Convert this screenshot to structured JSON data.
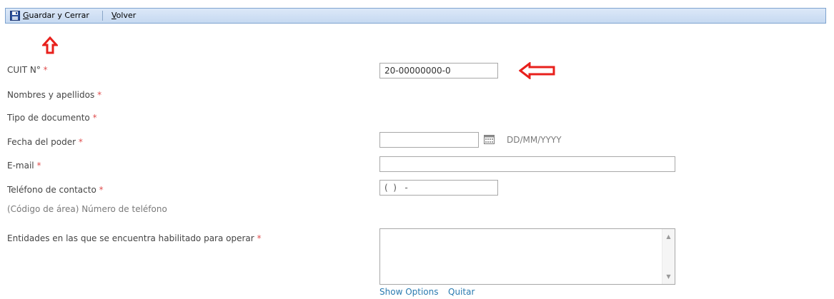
{
  "toolbar": {
    "save_access_key": "G",
    "save_label_rest": "uardar y Cerrar",
    "back_access_key": "V",
    "back_label_rest": "olver"
  },
  "form": {
    "cuit_label": "CUIT N°",
    "cuit_value": "20-00000000-0",
    "name_label": "Nombres y apellidos",
    "doc_type_label": "Tipo de documento",
    "date_label": "Fecha del poder",
    "date_value": "",
    "date_format_hint": "DD/MM/YYYY",
    "email_label": "E-mail",
    "email_value": "",
    "phone_label": "Teléfono de contacto",
    "phone_value": "(  )   -",
    "phone_hint": "(Código de área) Número de teléfono",
    "entities_label": "Entidades en las que se encuentra habilitado para operar",
    "required_marker": "*",
    "show_options_link": "Show Options",
    "remove_link": "Quitar"
  },
  "colors": {
    "arrow": "#e8201c",
    "toolbar_bg": "#c6d9f1",
    "required": "#e05050",
    "link": "#2a7ab0"
  },
  "icons": [
    "save-icon",
    "calendar-icon",
    "arrow-up-icon",
    "arrow-left-icon",
    "scroll-up-icon",
    "scroll-down-icon"
  ]
}
